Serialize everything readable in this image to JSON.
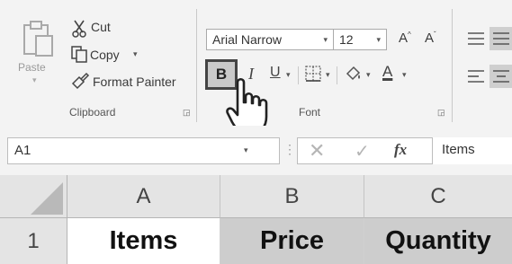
{
  "ribbon": {
    "clipboard": {
      "paste_label": "Paste",
      "cut_label": "Cut",
      "copy_label": "Copy",
      "format_painter_label": "Format Painter",
      "group_label": "Clipboard"
    },
    "font": {
      "font_name": "Arial Narrow",
      "font_size": "12",
      "bold_label": "B",
      "italic_label": "I",
      "underline_label": "U",
      "font_color_label": "A",
      "grow_label": "A",
      "shrink_label": "A",
      "group_label": "Font"
    }
  },
  "formula_bar": {
    "name_box": "A1",
    "fx_label": "fx",
    "formula_value": "Items"
  },
  "grid": {
    "columns": [
      "A",
      "B",
      "C"
    ],
    "rows": [
      {
        "header": "1",
        "cells": [
          "Items",
          "Price",
          "Quantity"
        ]
      }
    ]
  },
  "icons": [
    "paste-icon",
    "cut-icon",
    "copy-icon",
    "format-painter-icon",
    "borders-icon",
    "fill-color-icon",
    "align-icon",
    "hand-cursor-icon"
  ]
}
